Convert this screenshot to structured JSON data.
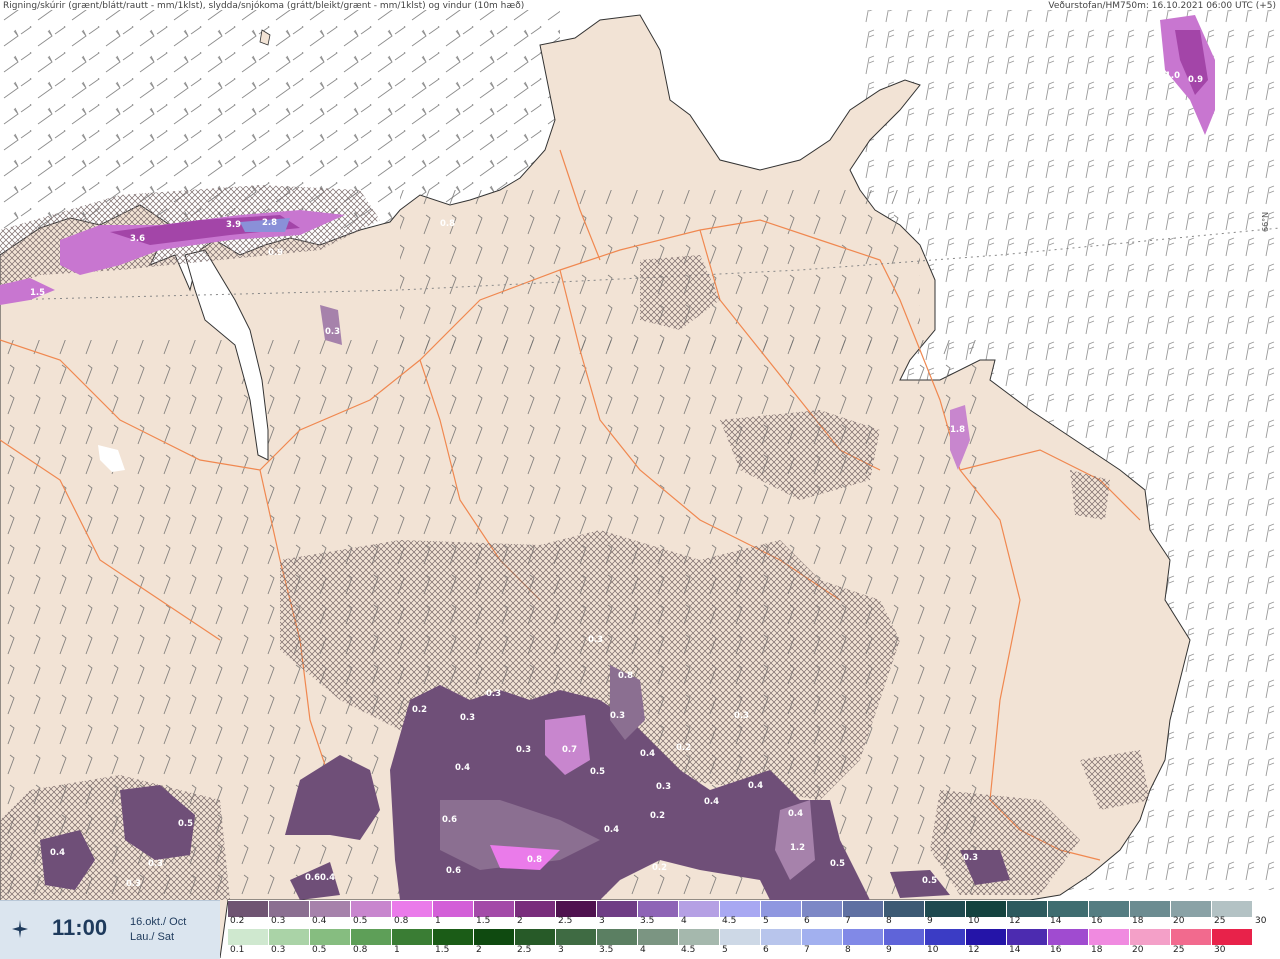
{
  "header": {
    "left_text": "Rigning/skúrir (grænt/blátt/rautt - mm/1klst), slydda/snjókoma (grátt/bleikt/grænt - mm/1klst) og vindur (10m hæð)",
    "right_text": "Veðurstofan/HM750m: 16.10.2021 06:00 UTC (+5)"
  },
  "timebox": {
    "time": "11:00",
    "date_line1": "16.okt./ Oct",
    "date_line2": "Lau./ Sat",
    "icon": "weather-service-logo-icon"
  },
  "map": {
    "latitude_label": "66°N",
    "precip_labels": [
      "3.6",
      "3.9",
      "2.8",
      "1.5",
      "0.3",
      "0.8",
      "0.9",
      "1.8",
      "1.0",
      "0.9",
      "0.5",
      "0.3",
      "0.3",
      "0.2",
      "0.3",
      "0.7",
      "0.4",
      "0.2",
      "0.8",
      "0.3",
      "0.3",
      "0.5",
      "0.4",
      "0.4",
      "0.3",
      "0.4",
      "0.2",
      "0.6",
      "0.8",
      "0.6",
      "0.4",
      "0.4",
      "0.2",
      "0.6",
      "1.2",
      "0.4",
      "0.3",
      "0.5",
      "0.3",
      "0.4",
      "0.3",
      "0.5",
      "0.3"
    ]
  },
  "legend": {
    "snow": {
      "ticks": [
        "0.2",
        "0.3",
        "0.4",
        "0.5",
        "0.8",
        "1",
        "1.5",
        "2",
        "2.5",
        "3",
        "3.5",
        "4",
        "4.5",
        "5",
        "6",
        "7",
        "8",
        "9",
        "10",
        "12",
        "14",
        "16",
        "18",
        "20",
        "25",
        "30"
      ],
      "colors": [
        "#6f5472",
        "#8b6f91",
        "#a682ab",
        "#c886ce",
        "#ea7bea",
        "#d35fd8",
        "#a34aa8",
        "#792d7c",
        "#4f124f",
        "#6f3d85",
        "#8e64b6",
        "#b5a0e4",
        "#a8a8f2",
        "#8f97e0",
        "#7d88c6",
        "#5f70a2",
        "#3d5a74",
        "#1f4a50",
        "#14433f",
        "#2d5a5e",
        "#3f6d70",
        "#557d82",
        "#6c8c91",
        "#8aa2a6",
        "#b3c2c4"
      ]
    },
    "rain": {
      "ticks": [
        "0.1",
        "0.3",
        "0.5",
        "0.8",
        "1",
        "1.5",
        "2",
        "2.5",
        "3",
        "3.5",
        "4",
        "4.5",
        "5",
        "6",
        "7",
        "8",
        "9",
        "10",
        "12",
        "14",
        "16",
        "18",
        "20",
        "25",
        "30"
      ],
      "colors": [
        "#cfe8cf",
        "#aad3a7",
        "#86bd80",
        "#5e9f58",
        "#3a7d34",
        "#1b5c17",
        "#0f4a10",
        "#275a28",
        "#3f6b43",
        "#5b7f62",
        "#7b9582",
        "#a5b8ad",
        "#cdd8e6",
        "#b8c5ec",
        "#a2b0ef",
        "#8189e7",
        "#5f64d9",
        "#3b3cc5",
        "#2414a8",
        "#4c2bb0",
        "#a04bd0",
        "#f08ae0",
        "#f4a0c8",
        "#f26a8e",
        "#e8224a"
      ]
    }
  }
}
